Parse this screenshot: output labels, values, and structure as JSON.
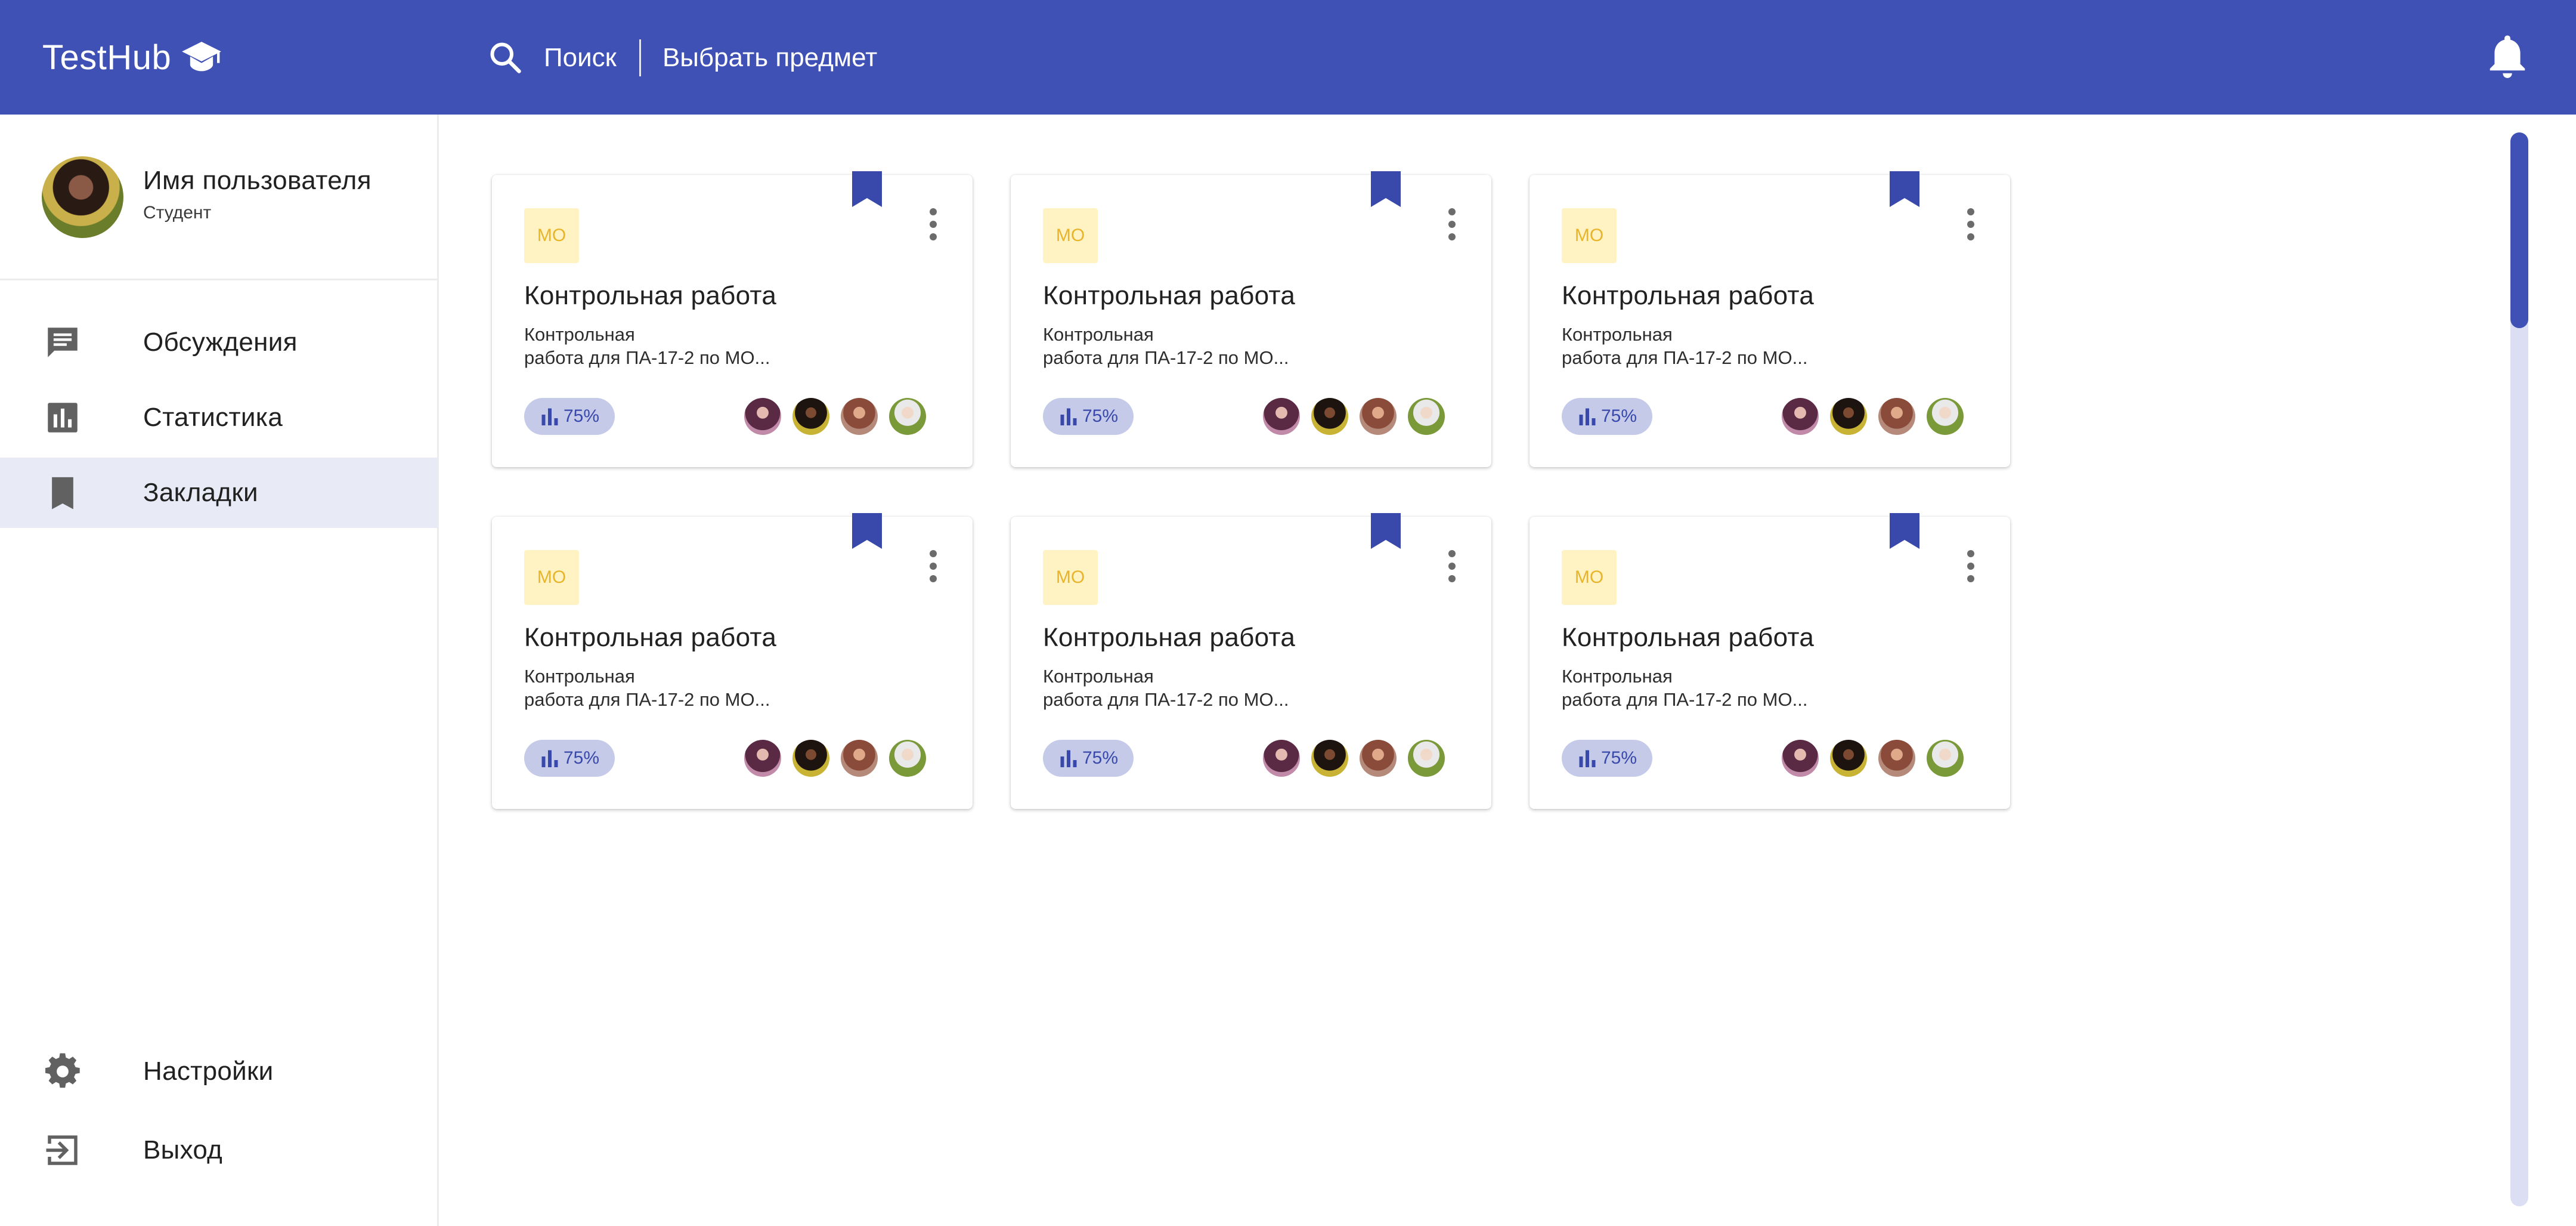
{
  "header": {
    "brand": "TestHub",
    "brand_icon": "graduation-cap-icon",
    "search_label": "Поиск",
    "subject_label": "Выбрать предмет",
    "notification_icon": "bell-icon",
    "color": "#3f51b5"
  },
  "sidebar": {
    "user": {
      "name": "Имя пользователя",
      "role": "Студент"
    },
    "items": [
      {
        "label": "Обсуждения",
        "icon": "chat-icon",
        "active": false
      },
      {
        "label": "Статистика",
        "icon": "bar-chart-icon",
        "active": false
      },
      {
        "label": "Закладки",
        "icon": "bookmark-icon",
        "active": true
      }
    ],
    "bottom_items": [
      {
        "label": "Настройки",
        "icon": "gear-icon"
      },
      {
        "label": "Выход",
        "icon": "logout-icon"
      }
    ],
    "active_color": "#e8eaf6"
  },
  "cards": [
    {
      "subject": "МО",
      "title": "Контрольная работа",
      "description": "Контрольная\nработа для ПА-17-2 по МО...",
      "progress": "75%",
      "bookmarked": true
    },
    {
      "subject": "МО",
      "title": "Контрольная работа",
      "description": "Контрольная\nработа для ПА-17-2 по МО...",
      "progress": "75%",
      "bookmarked": true
    },
    {
      "subject": "МО",
      "title": "Контрольная работа",
      "description": "Контрольная\nработа для ПА-17-2 по МО...",
      "progress": "75%",
      "bookmarked": true
    },
    {
      "subject": "МО",
      "title": "Контрольная работа",
      "description": "Контрольная\nработа для ПА-17-2 по МО...",
      "progress": "75%",
      "bookmarked": true
    },
    {
      "subject": "МО",
      "title": "Контрольная работа",
      "description": "Контрольная\nработа для ПА-17-2 по МО...",
      "progress": "75%",
      "bookmarked": true
    },
    {
      "subject": "МО",
      "title": "Контрольная работа",
      "description": "Контрольная\nработа для ПА-17-2 по МО...",
      "progress": "75%",
      "bookmarked": true
    }
  ],
  "colors": {
    "accent": "#3f51b5",
    "subject_badge_bg": "#fff3c4",
    "subject_badge_text": "#e8b42a",
    "progress_bg": "#c5cae9",
    "progress_text": "#3949ab"
  }
}
